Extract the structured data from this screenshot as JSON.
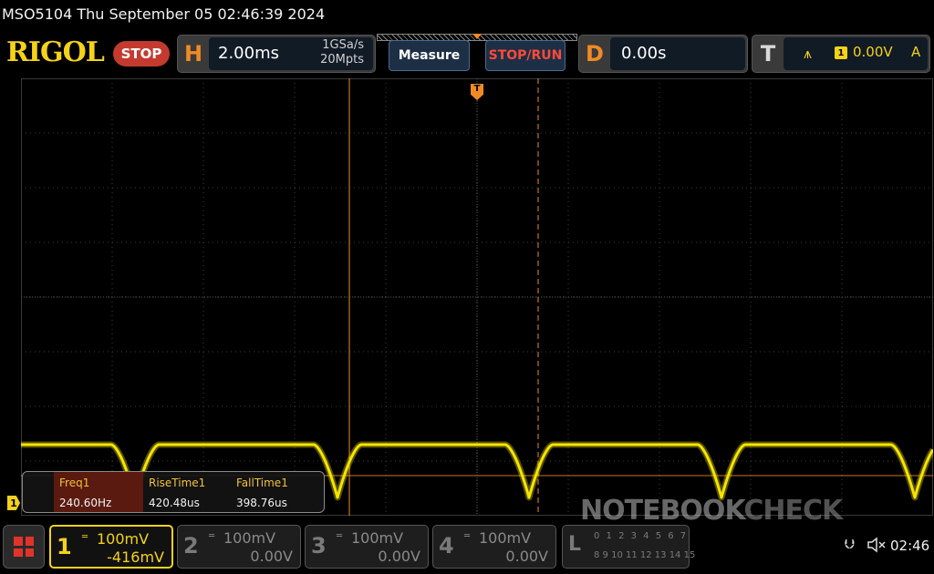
{
  "status": {
    "text": "MSO5104  Thu September 05 02:46:39 2024"
  },
  "brand": {
    "logo": "RIGOL",
    "run_state": "STOP"
  },
  "horizontal": {
    "letter": "H",
    "timebase": "2.00ms",
    "sample_rate": "1GSa/s",
    "memory_depth": "20Mpts"
  },
  "buttons": {
    "measure": "Measure",
    "stop_run": "STOP/RUN"
  },
  "delay": {
    "letter": "D",
    "value": "0.00s"
  },
  "trigger": {
    "letter": "T",
    "source": "1",
    "level": "0.00V",
    "mode": "A",
    "marker": "T"
  },
  "measurements": [
    {
      "name": "Freq1",
      "value": "240.60Hz"
    },
    {
      "name": "RiseTime1",
      "value": "420.48us"
    },
    {
      "name": "FallTime1",
      "value": "398.76us"
    }
  ],
  "channel_marker": "1",
  "channels": [
    {
      "num": "1",
      "scale": "100mV",
      "offset": "-416mV",
      "active": true
    },
    {
      "num": "2",
      "scale": "100mV",
      "offset": "0.00V",
      "active": false
    },
    {
      "num": "3",
      "scale": "100mV",
      "offset": "0.00V",
      "active": false
    },
    {
      "num": "4",
      "scale": "100mV",
      "offset": "0.00V",
      "active": false
    }
  ],
  "logic": {
    "letter": "L",
    "bits_low": "0 1 2 3 4 5 6 7",
    "bits_high": "8 9 10 11 12 13 14 15"
  },
  "watermark": {
    "text1": "NOTEBOOK",
    "text2": "CHECK"
  },
  "clock": "02:46",
  "colors": {
    "trace": "#f5e400",
    "accent": "#f08a24",
    "brand": "#f5d21a",
    "stop": "#c43a2e"
  },
  "icons": {
    "menu": "menu-grid-icon",
    "usb": "usb-icon",
    "speaker": "speaker-muted-icon"
  }
}
